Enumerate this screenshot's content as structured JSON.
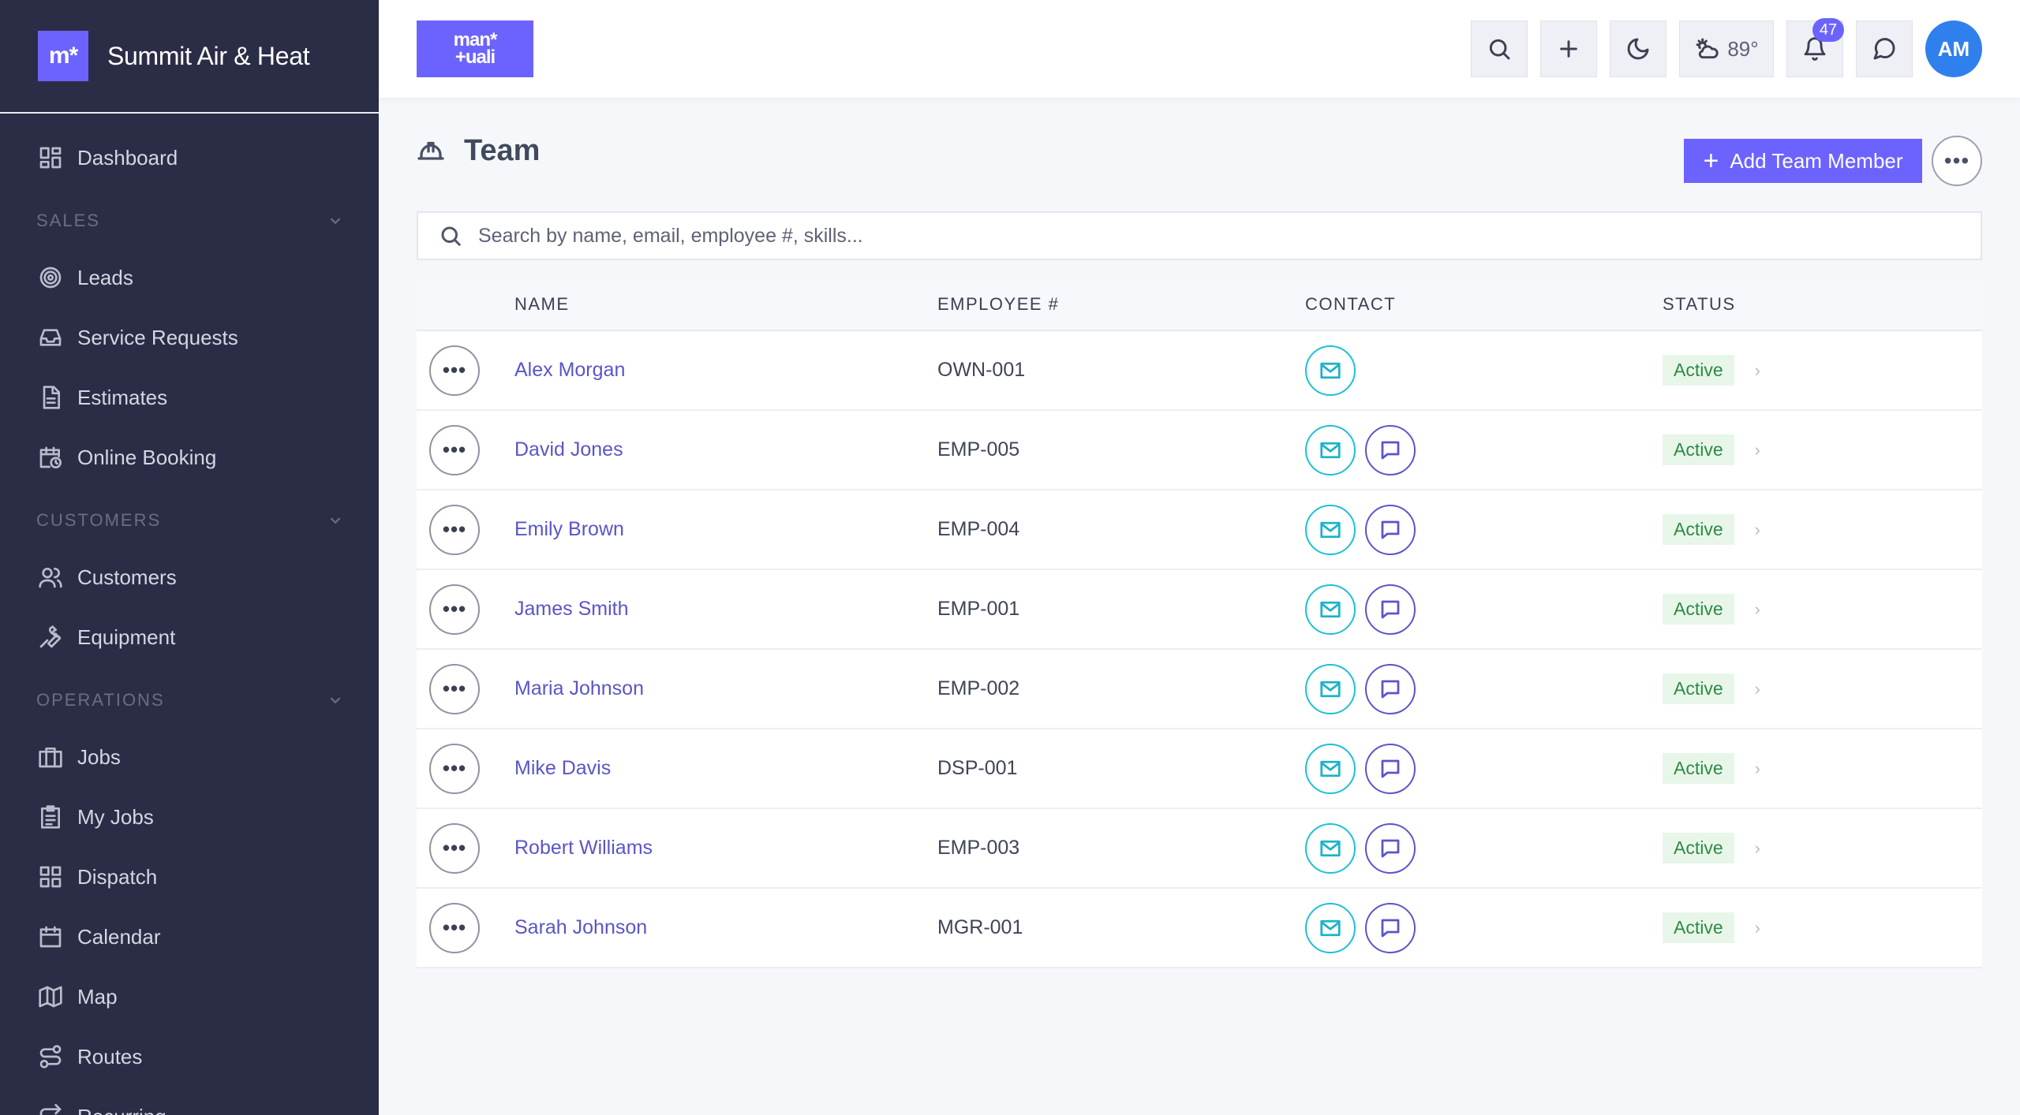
{
  "brand": {
    "logo": "m*",
    "name": "Summit Air & Heat"
  },
  "top_logo": {
    "line1": "man*",
    "line2": "+uali"
  },
  "sidebar": {
    "dashboard": "Dashboard",
    "sections": [
      {
        "title": "SALES",
        "items": [
          "Leads",
          "Service Requests",
          "Estimates",
          "Online Booking"
        ]
      },
      {
        "title": "CUSTOMERS",
        "items": [
          "Customers",
          "Equipment"
        ]
      },
      {
        "title": "OPERATIONS",
        "items": [
          "Jobs",
          "My Jobs",
          "Dispatch",
          "Calendar",
          "Map",
          "Routes",
          "Recurring"
        ]
      }
    ]
  },
  "topbar": {
    "weather": "89°",
    "notifications_count": "47",
    "avatar": "AM"
  },
  "page": {
    "title": "Team",
    "add_button": "Add Team Member",
    "search_placeholder": "Search by name, email, employee #, skills..."
  },
  "table": {
    "headers": [
      "NAME",
      "EMPLOYEE #",
      "CONTACT",
      "STATUS"
    ],
    "rows": [
      {
        "name": "Alex Morgan",
        "employee": "OWN-001",
        "status": "Active",
        "chat": false
      },
      {
        "name": "David Jones",
        "employee": "EMP-005",
        "status": "Active",
        "chat": true
      },
      {
        "name": "Emily Brown",
        "employee": "EMP-004",
        "status": "Active",
        "chat": true
      },
      {
        "name": "James Smith",
        "employee": "EMP-001",
        "status": "Active",
        "chat": true
      },
      {
        "name": "Maria Johnson",
        "employee": "EMP-002",
        "status": "Active",
        "chat": true
      },
      {
        "name": "Mike Davis",
        "employee": "DSP-001",
        "status": "Active",
        "chat": true
      },
      {
        "name": "Robert Williams",
        "employee": "EMP-003",
        "status": "Active",
        "chat": true
      },
      {
        "name": "Sarah Johnson",
        "employee": "MGR-001",
        "status": "Active",
        "chat": true
      }
    ]
  },
  "colors": {
    "sidebar": "#2b2d47",
    "accent": "#6c63ff",
    "mail": "#1cc0d6",
    "chat": "#5a55c9",
    "active_bg": "#e8f6ea",
    "active_text": "#2f8a42"
  }
}
